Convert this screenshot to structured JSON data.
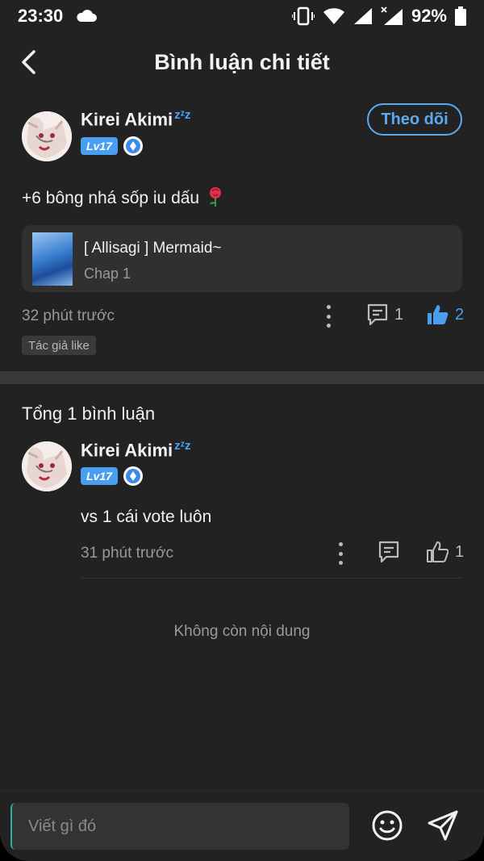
{
  "status_bar": {
    "time": "23:30",
    "battery": "92%"
  },
  "header": {
    "title": "Bình luận chi tiết"
  },
  "main_comment": {
    "author": "Kirei Akimi",
    "level": "Lv17",
    "follow_label": "Theo dõi",
    "text": "+6 bông nhá sốp iu dấu",
    "story": {
      "title": "[ Allisagi ] Mermaid~",
      "chapter": "Chap 1"
    },
    "time": "32 phút trước",
    "reply_count": "1",
    "like_count": "2",
    "author_like_tag": "Tác giả like"
  },
  "replies_section": {
    "total_label": "Tổng 1 bình luận",
    "replies": [
      {
        "author": "Kirei Akimi",
        "level": "Lv17",
        "text": "vs 1 cái vote luôn",
        "time": "31 phút trước",
        "like_count": "1"
      }
    ],
    "end_label": "Không còn nội dung"
  },
  "composer": {
    "placeholder": "Viết gì đó"
  },
  "colors": {
    "accent": "#4a9ef0",
    "background": "#222222",
    "muted": "#9a9a9a"
  },
  "icons": [
    "back-arrow-icon",
    "cloud-icon",
    "vibrate-icon",
    "wifi-icon",
    "signal-icon",
    "battery-icon",
    "rose-emoji-icon",
    "more-dots-icon",
    "comment-icon",
    "thumbs-up-icon",
    "smiley-icon",
    "send-icon",
    "level-badge-icon"
  ]
}
